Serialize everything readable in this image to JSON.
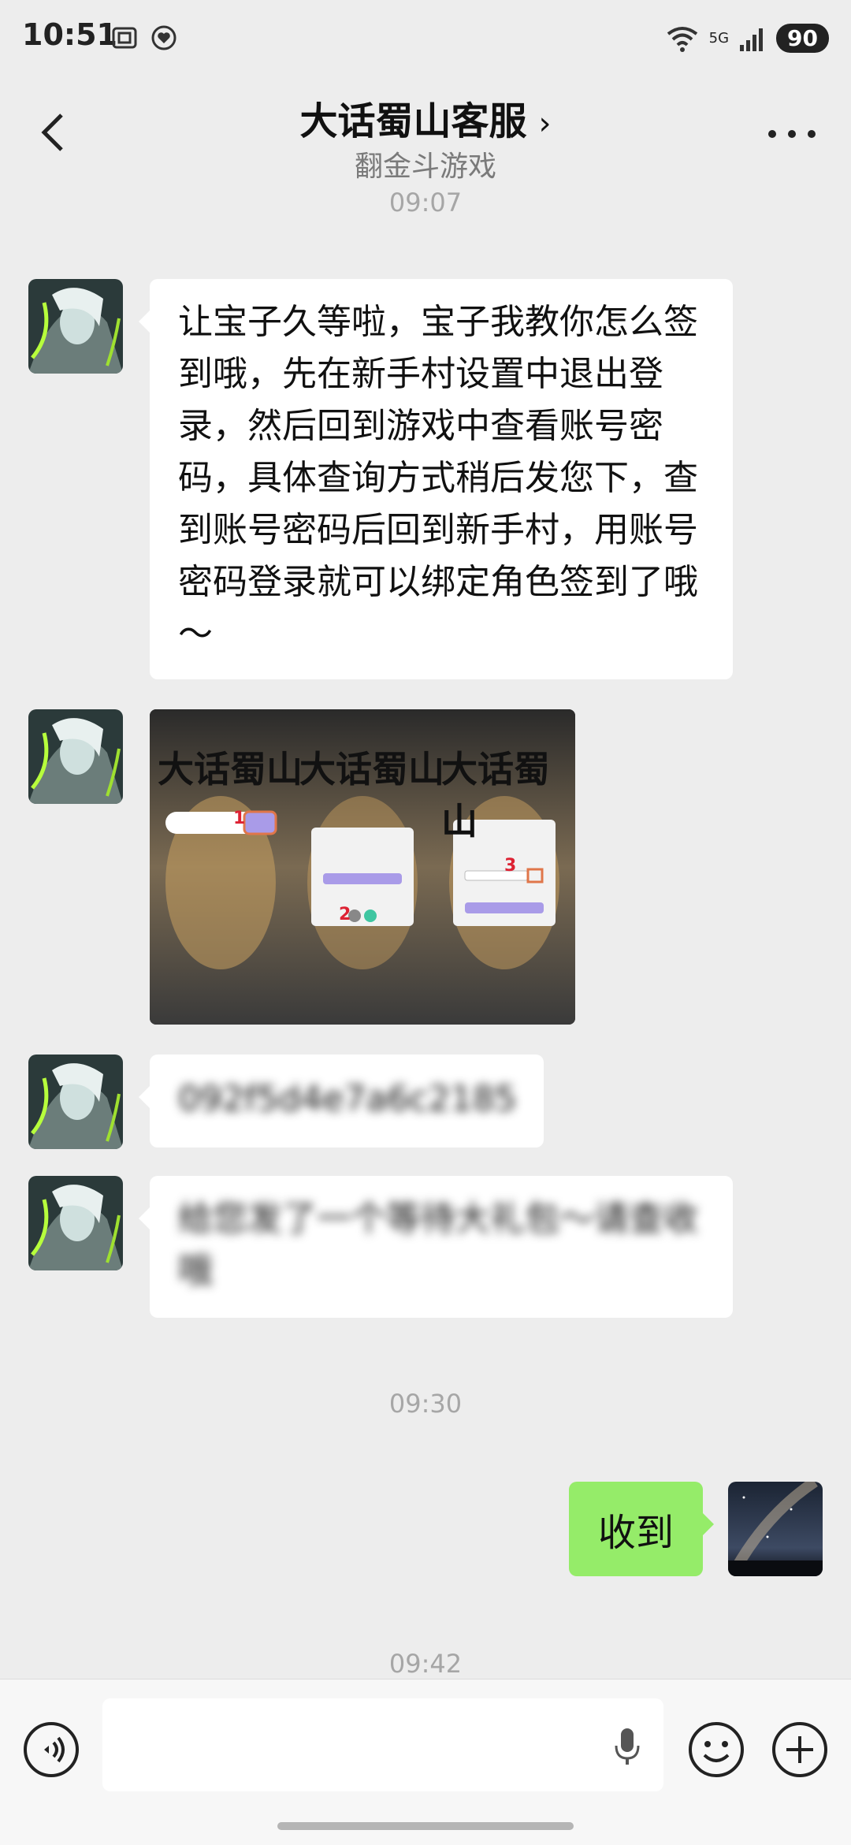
{
  "status_bar": {
    "time": "10:51",
    "battery": "90",
    "network": "5G"
  },
  "header": {
    "title": "大话蜀山客服",
    "subtitle": "翻金斗游戏"
  },
  "timestamps": [
    "09:07",
    "09:30",
    "09:42"
  ],
  "messages": [
    {
      "side": "left",
      "type": "text",
      "text": "让宝子久等啦，宝子我教你怎么签到哦，先在新手村设置中退出登录，然后回到游戏中查看账号密码，具体查询方式稍后发您下，查到账号密码后回到新手村，用账号密码登录就可以绑定角色签到了哦～"
    },
    {
      "side": "left",
      "type": "image",
      "image": {
        "logo_text": "大话蜀山",
        "step_numbers": [
          "1",
          "2",
          "3"
        ]
      }
    },
    {
      "side": "left",
      "type": "text",
      "text": "092f5d4e7a6c2185",
      "blurred": true
    },
    {
      "side": "left",
      "type": "text",
      "text": "给您发了一个等待大礼包～请查收哦",
      "blurred": true
    },
    {
      "side": "right",
      "type": "text",
      "text": "收到"
    }
  ],
  "colors": {
    "background": "#ededed",
    "bubble_self": "#95ec69",
    "bubble_other": "#ffffff"
  }
}
